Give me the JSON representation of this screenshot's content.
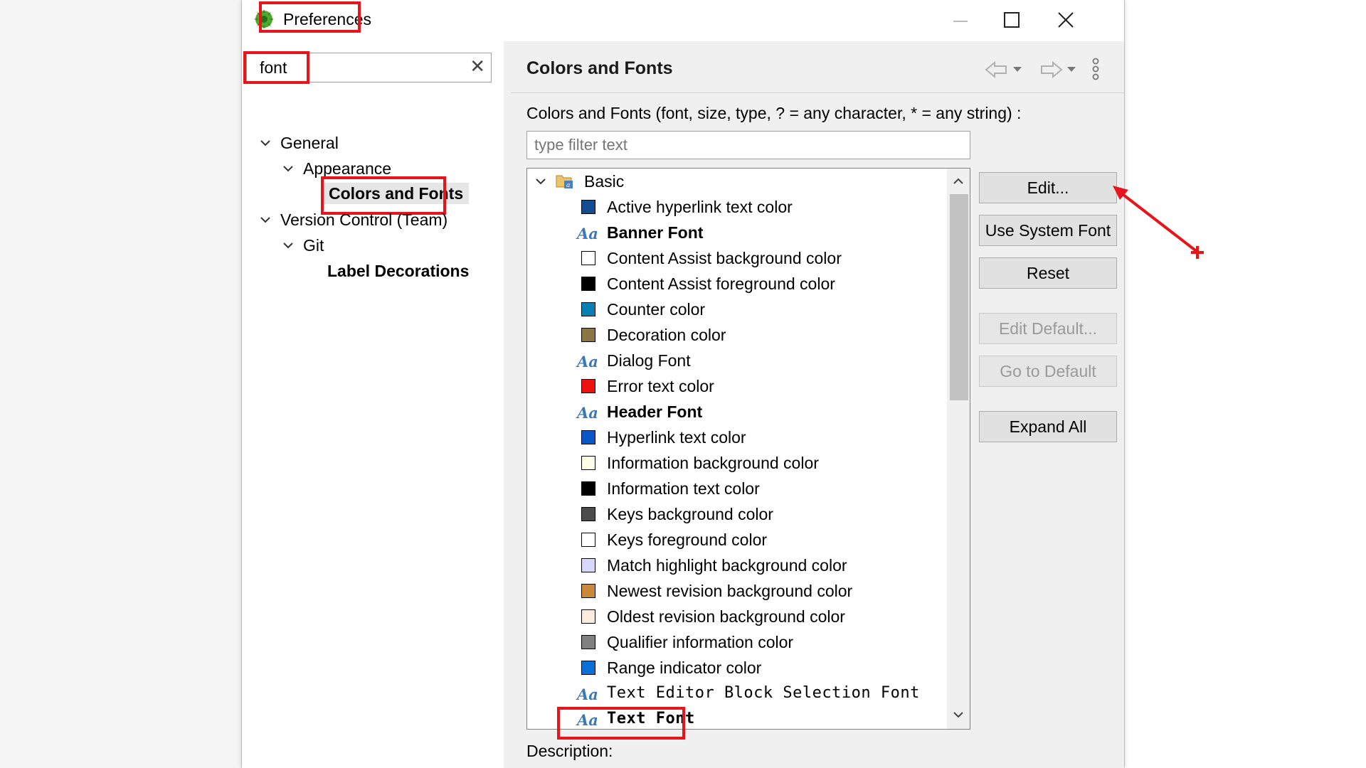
{
  "window": {
    "title": "Preferences"
  },
  "search": {
    "value": "font",
    "clear_glyph": "✕"
  },
  "tree": [
    {
      "label": "General",
      "expanded": true
    },
    {
      "label": "Appearance",
      "expanded": true
    },
    {
      "label": "Colors and Fonts",
      "selected": true
    },
    {
      "label": "Version Control (Team)",
      "expanded": true
    },
    {
      "label": "Git",
      "expanded": true
    },
    {
      "label": "Label Decorations"
    }
  ],
  "page": {
    "title": "Colors and Fonts",
    "description": "Colors and Fonts (font, size, type, ? = any character, * = any string) :",
    "filter_placeholder": "type filter text",
    "bottom_label": "Description:"
  },
  "list": {
    "category": "Basic",
    "items": [
      {
        "kind": "color",
        "label": "Active hyperlink text color",
        "color": "#124d8f"
      },
      {
        "kind": "font",
        "label": "Banner Font",
        "style": "bold"
      },
      {
        "kind": "color",
        "label": "Content Assist background color",
        "color": "#ffffff"
      },
      {
        "kind": "color",
        "label": "Content Assist foreground color",
        "color": "#000000"
      },
      {
        "kind": "color",
        "label": "Counter color",
        "color": "#0a7fb4"
      },
      {
        "kind": "color",
        "label": "Decoration color",
        "color": "#8a7545"
      },
      {
        "kind": "font",
        "label": "Dialog Font",
        "style": "normal"
      },
      {
        "kind": "color",
        "label": "Error text color",
        "color": "#ee1111"
      },
      {
        "kind": "font",
        "label": "Header Font",
        "style": "bold"
      },
      {
        "kind": "color",
        "label": "Hyperlink text color",
        "color": "#0a56c9"
      },
      {
        "kind": "color",
        "label": "Information background color",
        "color": "#fffde6"
      },
      {
        "kind": "color",
        "label": "Information text color",
        "color": "#000000"
      },
      {
        "kind": "color",
        "label": "Keys background color",
        "color": "#4c4c4c"
      },
      {
        "kind": "color",
        "label": "Keys foreground color",
        "color": "#ffffff"
      },
      {
        "kind": "color",
        "label": "Match highlight background color",
        "color": "#d8d8ff"
      },
      {
        "kind": "color",
        "label": "Newest revision background color",
        "color": "#c88a3a"
      },
      {
        "kind": "color",
        "label": "Oldest revision background color",
        "color": "#fbece0"
      },
      {
        "kind": "color",
        "label": "Qualifier information color",
        "color": "#808080"
      },
      {
        "kind": "color",
        "label": "Range indicator color",
        "color": "#0a6fd6"
      },
      {
        "kind": "font",
        "label": "Text Editor Block Selection Font",
        "style": "mono"
      },
      {
        "kind": "font",
        "label": "Text Font",
        "style": "mono-bold"
      }
    ]
  },
  "buttons": {
    "edit": "Edit...",
    "use_system_font": "Use System Font",
    "reset": "Reset",
    "edit_default": "Edit Default...",
    "go_to_default": "Go to Default",
    "expand_all": "Expand All"
  },
  "colors": {
    "highlight": "#e8141b",
    "font_icon": "#3a78b8"
  },
  "icons": {
    "app": "eclipse-icon",
    "back": "back-arrow-icon",
    "forward": "forward-arrow-icon",
    "menu": "view-menu-icon",
    "annotation": "red-arrow-icon"
  }
}
